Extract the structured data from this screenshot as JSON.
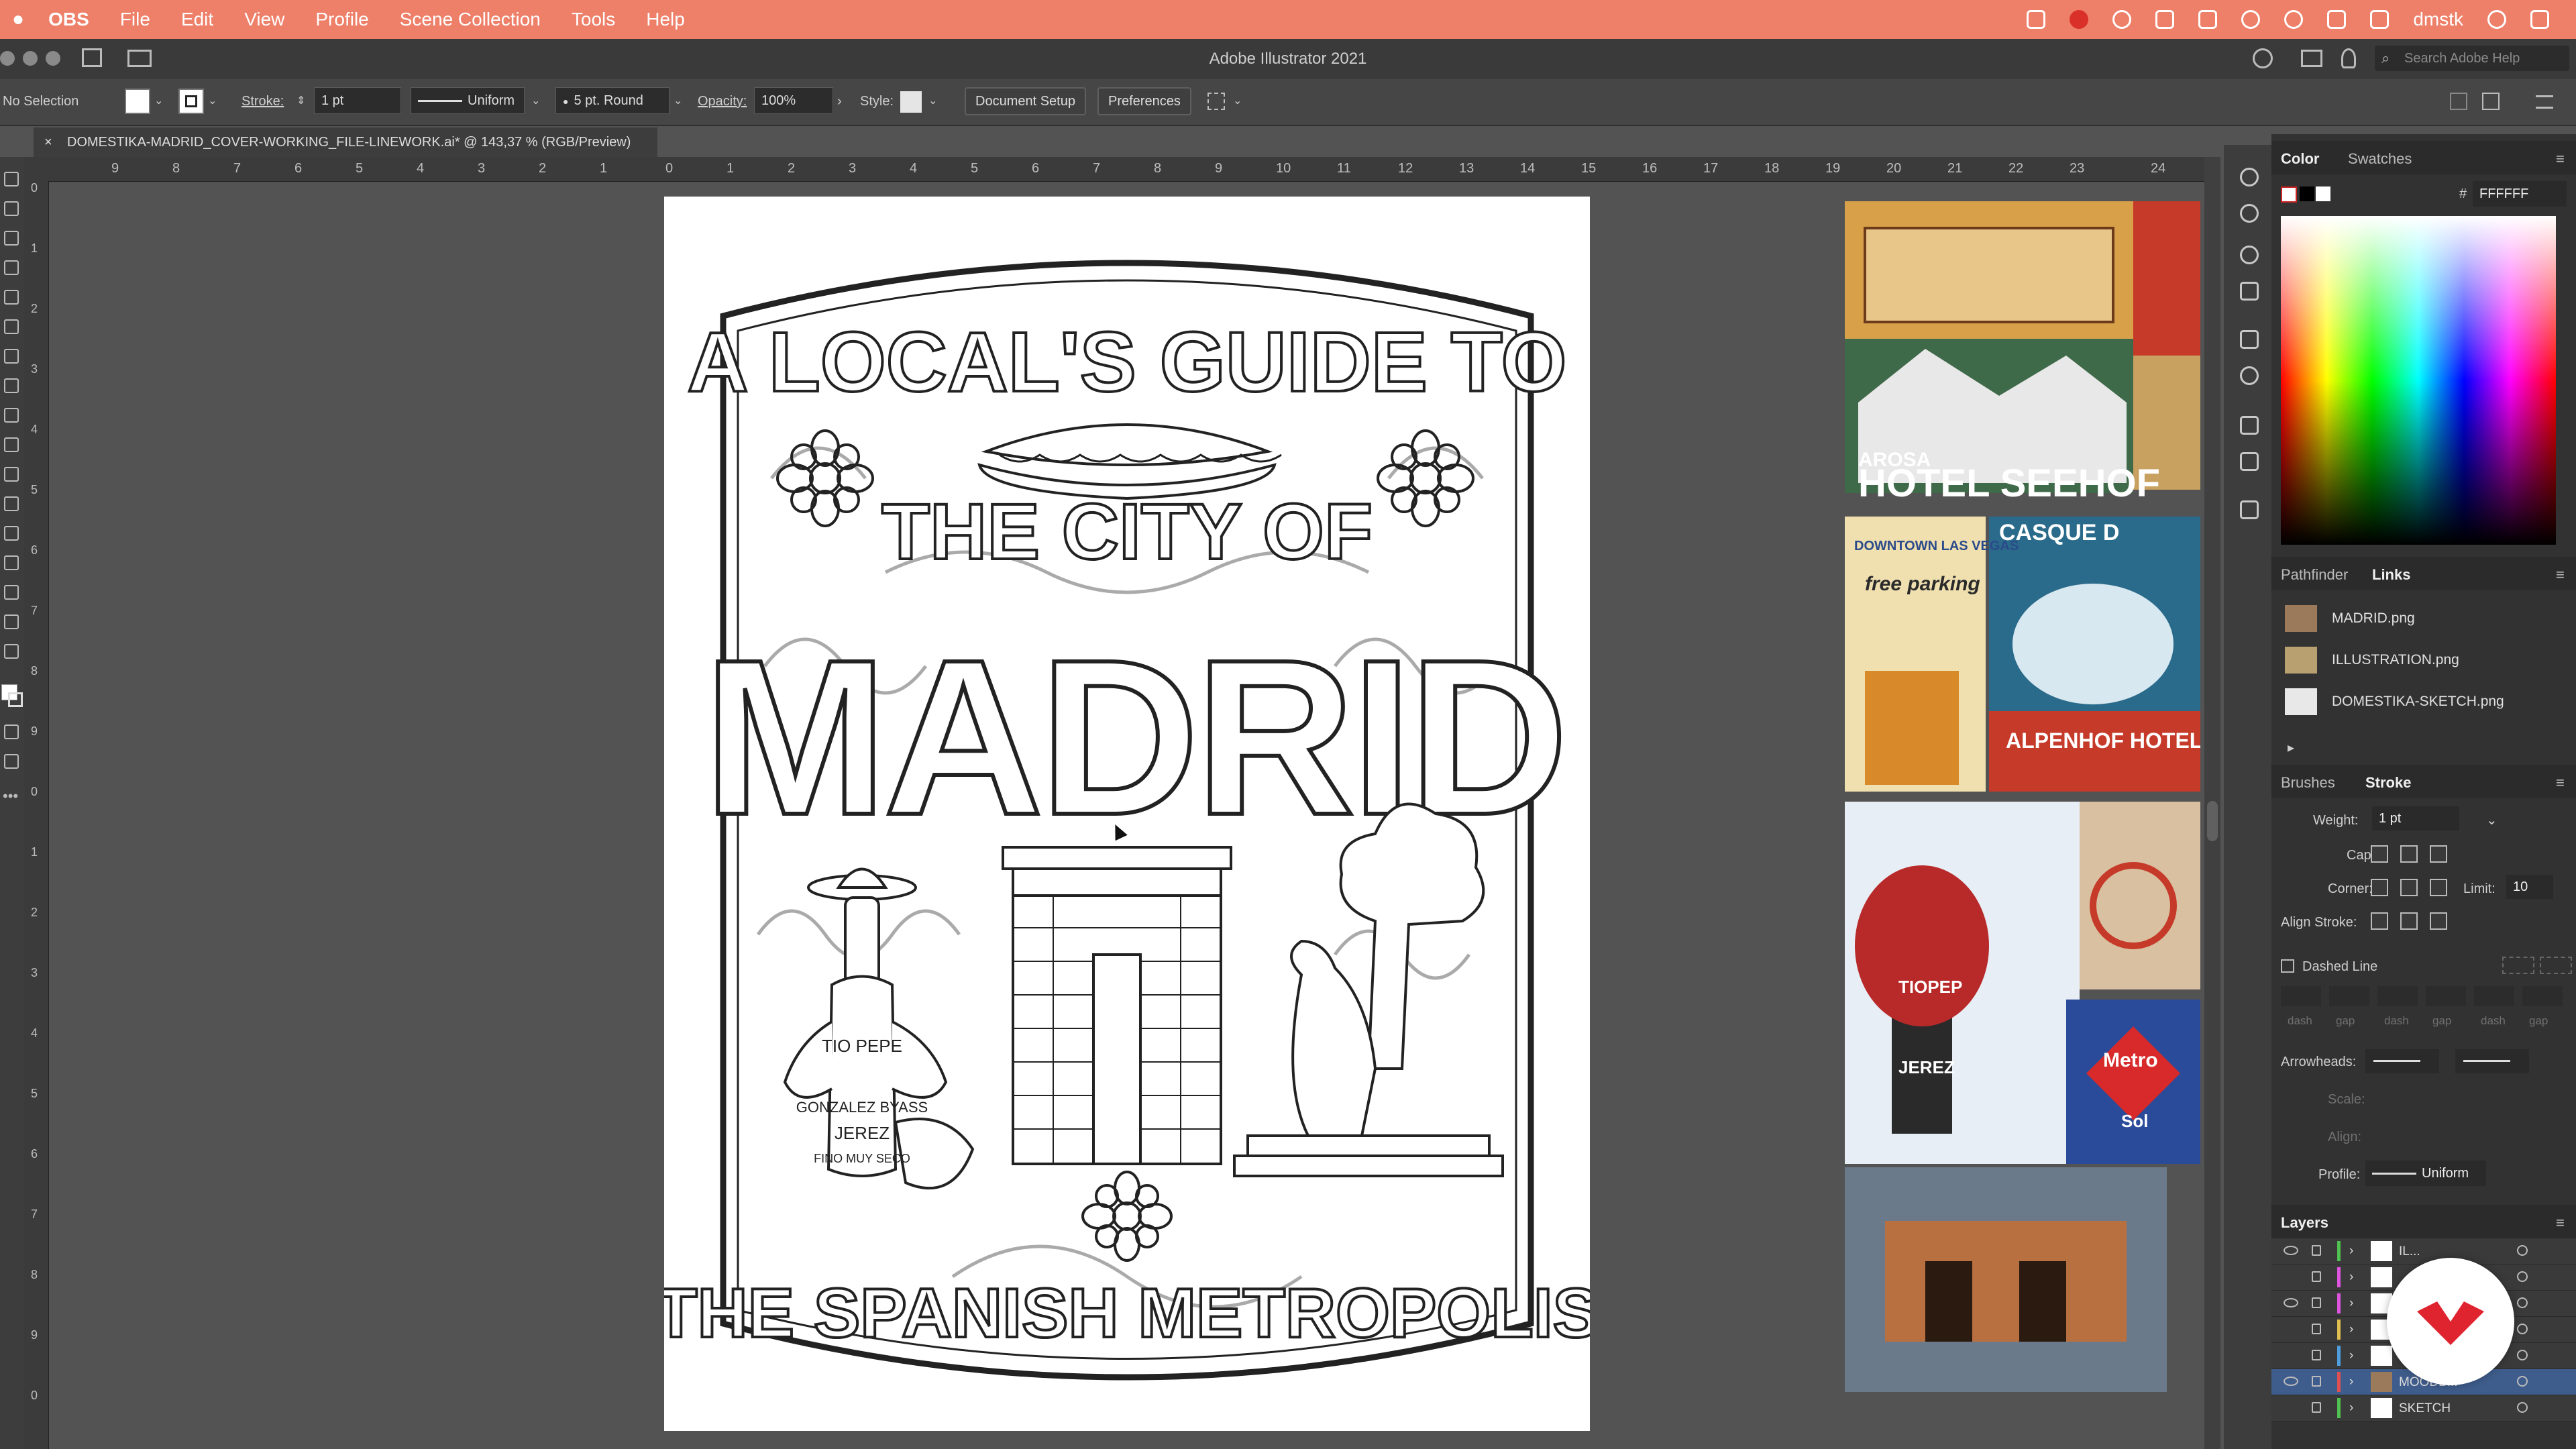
{
  "menubar": {
    "app": "OBS",
    "items": [
      "File",
      "Edit",
      "View",
      "Profile",
      "Scene Collection",
      "Tools",
      "Help"
    ],
    "user": "dmstk"
  },
  "window": {
    "title": "Adobe Illustrator 2021",
    "search_placeholder": "Search Adobe Help"
  },
  "control_bar": {
    "selection": "No Selection",
    "stroke_label": "Stroke:",
    "stroke_value": "1 pt",
    "profile": "Uniform",
    "brush": "5 pt. Round",
    "opacity_label": "Opacity:",
    "opacity_value": "100%",
    "style_label": "Style:",
    "document_setup": "Document Setup",
    "preferences": "Preferences"
  },
  "document_tab": {
    "close": "×",
    "name": "DOMESTIKA-MADRID_COVER-WORKING_FILE-LINEWORK.ai* @ 143,37 % (RGB/Preview)"
  },
  "ruler": {
    "h_ticks": [
      "9",
      "8",
      "7",
      "6",
      "5",
      "4",
      "3",
      "2",
      "1",
      "0",
      "1",
      "2",
      "3",
      "4",
      "5",
      "6",
      "7",
      "8",
      "9",
      "10",
      "11",
      "12",
      "13",
      "14",
      "15",
      "16",
      "17",
      "18",
      "19",
      "20",
      "21",
      "22",
      "23",
      "24"
    ],
    "v_ticks": [
      "0",
      "1",
      "2",
      "3",
      "4",
      "5",
      "6",
      "7",
      "8",
      "9",
      "0",
      "1",
      "2",
      "3",
      "4",
      "5",
      "6",
      "7",
      "8",
      "9",
      "0"
    ]
  },
  "artwork": {
    "title_top": "A LOCAL'S GUIDE TO",
    "title_mid": "THE CITY OF",
    "title_main": "MADRID",
    "title_bottom": "THE SPANISH METROPOLIS",
    "bottle_label_1": "TIO PEPE",
    "bottle_label_2": "GONZALEZ BYASS",
    "bottle_label_3": "JEREZ",
    "bottle_label_4": "FINO MUY SECO"
  },
  "moodboard": {
    "hotel_text": "HOTEL SEEHOF",
    "hotel_sub": "AROSA",
    "casque": "CASQUE D",
    "vegas": "DOWNTOWN LAS VEGAS",
    "parking": "free parking",
    "alpenhof": "ALPENHOF HOTEL",
    "metro": "Metro",
    "sol": "Sol",
    "bottle_tio": "TIOPEP",
    "bottle_jerez": "JEREZ"
  },
  "color_panel": {
    "tab_color": "Color",
    "tab_swatches": "Swatches",
    "hex_label": "#",
    "hex_value": "FFFFFF"
  },
  "links_panel": {
    "tab_pathfinder": "Pathfinder",
    "tab_links": "Links",
    "files": [
      "MADRID.png",
      "ILLUSTRATION.png",
      "DOMESTIKA-SKETCH.png"
    ]
  },
  "stroke_panel": {
    "tab_brushes": "Brushes",
    "tab_stroke": "Stroke",
    "weight_label": "Weight:",
    "weight_value": "1 pt",
    "cap_label": "Cap:",
    "corner_label": "Corner:",
    "limit_label": "Limit:",
    "limit_value": "10",
    "align_label": "Align Stroke:",
    "dashed_label": "Dashed Line",
    "dash_labels": [
      "dash",
      "gap",
      "dash",
      "gap",
      "dash",
      "gap"
    ],
    "arrowheads_label": "Arrowheads:",
    "scale_label": "Scale:",
    "align2_label": "Align:",
    "profile_label": "Profile:",
    "profile_value": "Uniform"
  },
  "layers_panel": {
    "title": "Layers",
    "layers": [
      {
        "name": "IL...",
        "color": "#4fc24f",
        "visible": true
      },
      {
        "name": "",
        "color": "#e055e0",
        "visible": false
      },
      {
        "name": "",
        "color": "#e055e0",
        "visible": true
      },
      {
        "name": "",
        "color": "#e0c04f",
        "visible": false
      },
      {
        "name": "",
        "color": "#4f9fe0",
        "visible": false
      },
      {
        "name": "MOODB...",
        "color": "#e05050",
        "visible": true
      },
      {
        "name": "SKETCH",
        "color": "#4fc24f",
        "visible": false
      }
    ]
  },
  "colors": {
    "menubar": "#ee7f68",
    "accent": "#d9302a"
  }
}
